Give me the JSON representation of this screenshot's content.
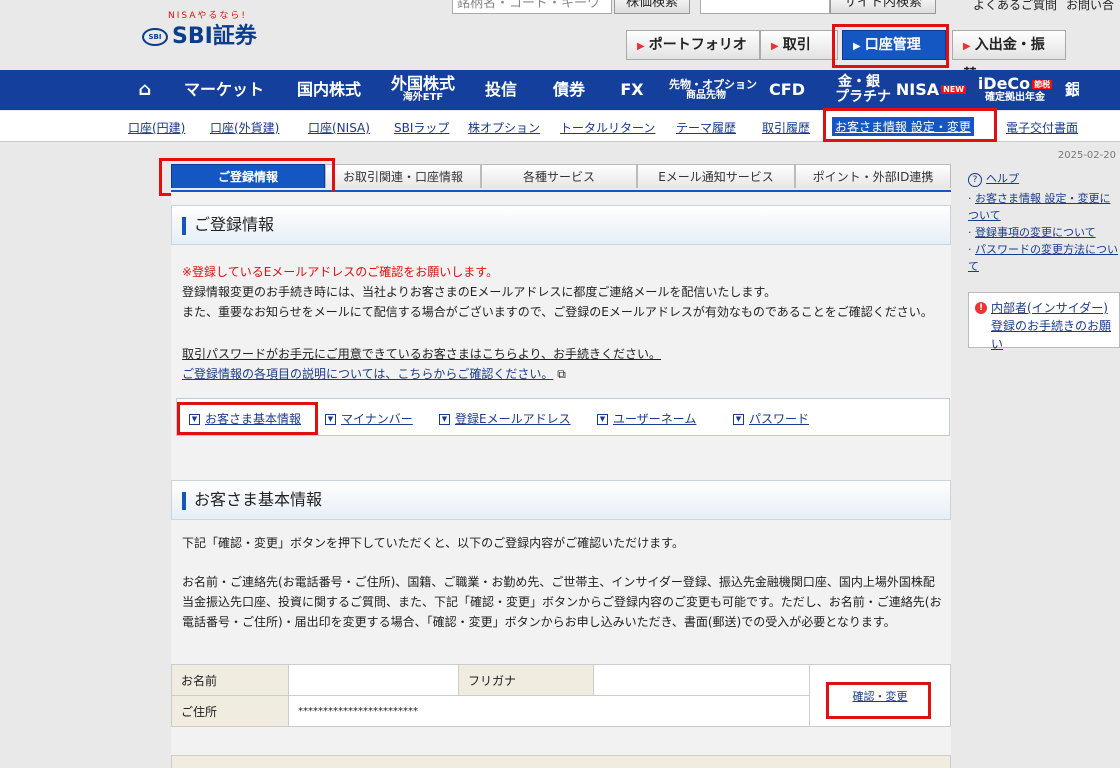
{
  "header": {
    "logo_sub": "NISAやるなら!",
    "logo_mark": "SBI",
    "logo_text": "SBI証券",
    "search_placeholder": "銘柄名・コード・キーワ",
    "stock_search_button": "株価検索",
    "site_search_button": "サイト内検索",
    "faq_link": "よくあるご質問",
    "contact_link": "お問い合",
    "quick_nav": [
      "ポートフォリオ",
      "取引",
      "口座管理",
      "入出金・振替"
    ]
  },
  "global_nav": {
    "items": [
      {
        "label": "マーケット"
      },
      {
        "label": "国内株式"
      },
      {
        "label": "外国株式",
        "sub": "海外ETF"
      },
      {
        "label": "投信"
      },
      {
        "label": "債券"
      },
      {
        "label": "FX"
      },
      {
        "label": "先物・オプション",
        "sub": "商品先物"
      },
      {
        "label": "CFD"
      },
      {
        "label": "金・銀",
        "sub": "プラチナ"
      },
      {
        "label": "NISA",
        "badge": "NEW"
      },
      {
        "label": "iDeCo",
        "badge": "節税",
        "sub": "確定拠出年金"
      },
      {
        "label": "銀"
      }
    ]
  },
  "sub_nav": [
    "口座(円建)",
    "口座(外貨建)",
    "口座(NISA)",
    "SBIラップ",
    "株オプション",
    "トータルリターン",
    "テーマ履歴",
    "取引履歴",
    "お客さま情報 設定・変更",
    "電子交付書面"
  ],
  "date": "2025-02-20",
  "tabs": [
    "ご登録情報",
    "お取引関連・口座情報",
    "各種サービス",
    "Eメール通知サービス",
    "ポイント・外部ID連携"
  ],
  "registration": {
    "title": "ご登録情報",
    "notice": "※登録しているEメールアドレスのご確認をお願いします。",
    "para1": "登録情報変更のお手続き時には、当社よりお客さまのEメールアドレスに都度ご連絡メールを配信いたします。",
    "para2": "また、重要なお知らせをメールにて配信する場合がございますので、ご登録のEメールアドレスが有効なものであることをご確認ください。",
    "link1": "取引パスワードがお手元にご用意できているお客さまはこちらより、お手続きください。",
    "link2": "ご登録情報の各項目の説明については、こちらからご確認ください。"
  },
  "anchors": [
    "お客さま基本情報",
    "マイナンバー",
    "登録Eメールアドレス",
    "ユーザーネーム",
    "パスワード"
  ],
  "basic": {
    "title": "お客さま基本情報",
    "para1": "下記「確認・変更」ボタンを押下していただくと、以下のご登録内容がご確認いただけます。",
    "para2": "お名前・ご連絡先(お電話番号・ご住所)、国籍、ご職業・お勤め先、ご世帯主、インサイダー登録、振込先金融機関口座、国内上場外国株配当金振込先口座、投資に関するご質問、また、下記「確認・変更」ボタンからご登録内容のご変更も可能です。ただし、お名前・ご連絡先(お電話番号・ご住所)・届出印を変更する場合、「確認・変更」ボタンからお申し込みいただき、書面(郵送)での受入が必要となります。",
    "name_label": "お名前",
    "name_value": "",
    "kana_label": "フリガナ",
    "kana_value": "",
    "address_label": "ご住所",
    "address_value": "************************",
    "confirm_button": "確認・変更"
  },
  "sidebar": {
    "help_title": "ヘルプ",
    "help_items": [
      "お客さま情報 設定・変更について",
      "登録事項の変更について",
      "パスワードの変更方法について"
    ],
    "insider_link": "内部者(インサイダー)登録のお手続きのお願い"
  },
  "colors": {
    "nav_blue": "#143f9c",
    "accent_blue": "#1557c2",
    "highlight_red": "#e01010"
  }
}
